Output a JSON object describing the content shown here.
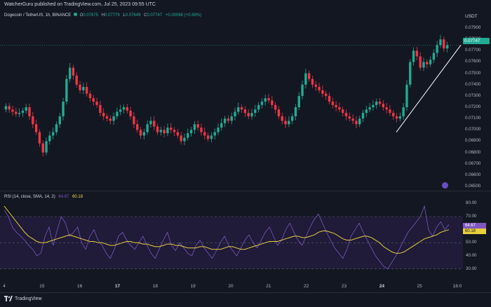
{
  "header": {
    "publisher": "WatcherGuru published on TradingView.com, Jul 25, 2023 09:55 UTC"
  },
  "symbol": {
    "name": "Dogecoin / TetherUS, 1h, BINANCE",
    "open_label": "O",
    "open": "0.07675",
    "high_label": "H",
    "high": "0.07779",
    "low_label": "L",
    "low": "0.07649",
    "close_label": "C",
    "close": "0.07747",
    "change": "+0.00068 (+0.89%)"
  },
  "price_axis": {
    "currency": "USDT",
    "ticks": [
      "0.07900",
      "0.07800",
      "0.07700",
      "0.07600",
      "0.07500",
      "0.07400",
      "0.07300",
      "0.07200",
      "0.07100",
      "0.07000",
      "0.06900",
      "0.06800",
      "0.06700",
      "0.06600",
      "0.06500"
    ],
    "current_price": "0.07747"
  },
  "rsi": {
    "label": "RSI (14, close, SMA, 14, 2)",
    "value": "64.67",
    "sma_value": "60.18",
    "ticks": [
      "80.00",
      "70.00",
      "60.00",
      "50.00",
      "40.00",
      "30.00"
    ],
    "tag1": "64.67",
    "tag2": "60.18"
  },
  "time_axis": [
    {
      "label": "4",
      "bold": false
    },
    {
      "label": "15",
      "bold": false
    },
    {
      "label": "16",
      "bold": false
    },
    {
      "label": "17",
      "bold": true
    },
    {
      "label": "18",
      "bold": false
    },
    {
      "label": "19",
      "bold": false
    },
    {
      "label": "20",
      "bold": false
    },
    {
      "label": "21",
      "bold": false
    },
    {
      "label": "22",
      "bold": false
    },
    {
      "label": "23",
      "bold": false
    },
    {
      "label": "24",
      "bold": true
    },
    {
      "label": "25",
      "bold": false
    },
    {
      "label": "18:0",
      "bold": false
    }
  ],
  "footer": {
    "logo_text": "TradingView"
  },
  "colors": {
    "up": "#22ab94",
    "down": "#f23645",
    "rsi_line": "#7e57c2",
    "rsi_sma": "#e8cf3c",
    "background": "#131722",
    "trendline": "#ffffff"
  },
  "chart_data": {
    "type": "candlestick",
    "title": "Dogecoin / TetherUS, 1h, BINANCE",
    "ylim": [
      0.065,
      0.0795
    ],
    "days": [
      "4",
      "15",
      "16",
      "17",
      "18",
      "19",
      "20",
      "21",
      "22",
      "23",
      "24",
      "25"
    ],
    "closes": [
      0.0721,
      0.0718,
      0.0716,
      0.0714,
      0.0715,
      0.0717,
      0.072,
      0.0712,
      0.0705,
      0.0698,
      0.0688,
      0.068,
      0.069,
      0.0695,
      0.0698,
      0.0705,
      0.0712,
      0.0725,
      0.0745,
      0.0755,
      0.0748,
      0.074,
      0.0735,
      0.0738,
      0.0732,
      0.0728,
      0.0725,
      0.0722,
      0.0715,
      0.0712,
      0.071,
      0.0708,
      0.0712,
      0.0716,
      0.0718,
      0.072,
      0.0717,
      0.0712,
      0.0705,
      0.07,
      0.0695,
      0.0698,
      0.0705,
      0.0708,
      0.0703,
      0.0698,
      0.07,
      0.0697,
      0.0702,
      0.07,
      0.0698,
      0.0695,
      0.069,
      0.0693,
      0.0697,
      0.07,
      0.0705,
      0.0702,
      0.0698,
      0.0695,
      0.0692,
      0.0695,
      0.0698,
      0.0702,
      0.0706,
      0.071,
      0.0708,
      0.0712,
      0.0716,
      0.072,
      0.0718,
      0.0715,
      0.0712,
      0.0715,
      0.0718,
      0.0722,
      0.0725,
      0.0728,
      0.0726,
      0.0722,
      0.0718,
      0.0712,
      0.0708,
      0.0705,
      0.0708,
      0.0712,
      0.072,
      0.073,
      0.074,
      0.075,
      0.0745,
      0.074,
      0.0738,
      0.0735,
      0.0732,
      0.073,
      0.0725,
      0.0722,
      0.072,
      0.0718,
      0.0715,
      0.0712,
      0.071,
      0.0708,
      0.0705,
      0.071,
      0.0715,
      0.0718,
      0.072,
      0.0722,
      0.0725,
      0.0723,
      0.072,
      0.0718,
      0.0715,
      0.0712,
      0.071,
      0.0712,
      0.072,
      0.074,
      0.076,
      0.077,
      0.0765,
      0.0755,
      0.076,
      0.0758,
      0.0762,
      0.0768,
      0.0775,
      0.078,
      0.0772,
      0.0775
    ],
    "rsi": [
      75,
      70,
      62,
      58,
      55,
      52,
      48,
      45,
      40,
      42,
      55,
      62,
      48,
      60,
      70,
      65,
      55,
      58,
      62,
      50,
      45,
      55,
      60,
      52,
      48,
      42,
      38,
      45,
      55,
      58,
      52,
      48,
      45,
      50,
      55,
      48,
      42,
      38,
      45,
      52,
      58,
      48,
      44,
      50,
      46,
      42,
      40,
      48,
      52,
      46,
      42,
      38,
      44,
      50,
      55,
      48,
      44,
      40,
      46,
      52,
      56,
      50,
      46,
      52,
      58,
      62,
      55,
      48,
      52,
      60,
      65,
      58,
      52,
      48,
      55,
      62,
      68,
      72,
      65,
      58,
      52,
      46,
      42,
      38,
      45,
      55,
      60,
      65,
      58,
      52,
      46,
      40,
      36,
      32,
      30,
      35,
      40,
      46,
      52,
      58,
      62,
      66,
      70,
      78,
      60,
      55,
      62,
      66,
      60,
      64
    ],
    "rsi_sma": [
      78,
      74,
      70,
      66,
      62,
      58,
      55,
      53,
      51,
      50,
      50,
      51,
      52,
      53,
      54,
      55,
      56,
      55,
      54,
      53,
      52,
      51,
      51,
      50,
      50,
      49,
      48,
      48,
      49,
      50,
      51,
      51,
      50,
      50,
      49,
      49,
      48,
      47,
      47,
      48,
      49,
      49,
      48,
      48,
      47,
      46,
      46,
      46,
      47,
      47,
      46,
      45,
      45,
      45,
      46,
      47,
      47,
      46,
      45,
      45,
      46,
      47,
      48,
      49,
      50,
      51,
      51,
      51,
      52,
      53,
      54,
      55,
      55,
      54,
      54,
      55,
      56,
      58,
      59,
      59,
      58,
      57,
      55,
      53,
      52,
      52,
      53,
      54,
      55,
      55,
      54,
      52,
      50,
      47,
      45,
      43,
      42,
      42,
      43,
      45,
      47,
      49,
      51,
      53,
      54,
      55,
      56,
      58,
      59,
      60
    ]
  }
}
